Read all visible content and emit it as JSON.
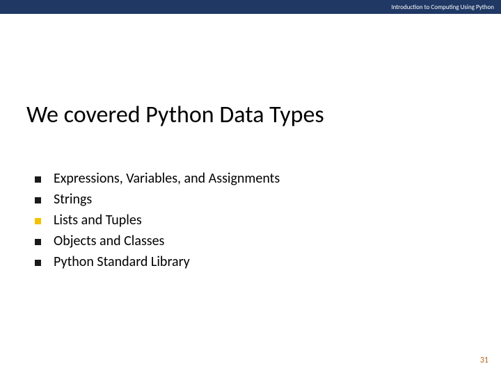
{
  "header": {
    "text": "Introduction to Computing Using Python"
  },
  "title": "We covered Python Data Types",
  "bullets": [
    {
      "text": "Expressions, Variables, and Assignments",
      "color": "#1a1a1a"
    },
    {
      "text": "Strings",
      "color": "#1a1a1a"
    },
    {
      "text": "Lists and Tuples",
      "color": "#f2c200"
    },
    {
      "text": "Objects and Classes",
      "color": "#1a1a1a"
    },
    {
      "text": "Python Standard Library",
      "color": "#1a1a1a"
    }
  ],
  "page_number": "31"
}
